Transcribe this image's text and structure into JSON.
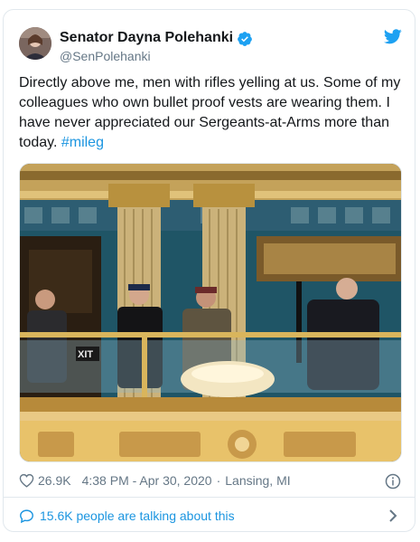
{
  "tweet": {
    "author_name": "Senator Dayna Polehanki",
    "author_handle": "@SenPolehanki",
    "text_before_hashtag": "Directly above me, men with rifles yelling at us. Some of my colleagues who own bullet proof vests are wearing them. I have never appreciated our Sergeants-at-Arms more than today. ",
    "hashtag": "#mileg",
    "likes": "26.9K",
    "timestamp": "4:38 PM - Apr 30, 2020",
    "separator": "·",
    "location": "Lansing, MI",
    "talking_text": "15.6K people are talking about this",
    "photo_sign": "XIT"
  },
  "icons": {
    "verified": "verified-badge-icon",
    "bird": "twitter-bird-icon",
    "heart": "heart-icon",
    "info": "info-icon",
    "bubble": "speech-bubble-icon",
    "chevron": "chevron-right-icon"
  },
  "colors": {
    "link": "#1b95e0",
    "secondary_text": "#657786",
    "border": "#e1e8ed",
    "text": "#14171a"
  }
}
